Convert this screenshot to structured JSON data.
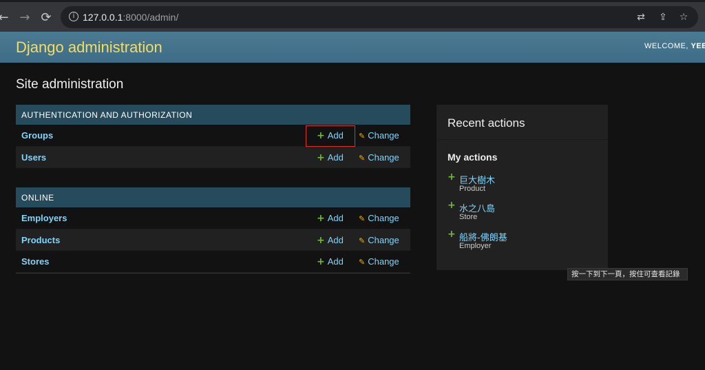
{
  "browser": {
    "back_icon": "←",
    "forward_icon": "→",
    "reload_icon": "⟳",
    "url_host": "127.0.0.1",
    "url_path": ":8000/admin/",
    "translate_icon": "⇄",
    "share_icon": "⇪",
    "star_icon": "☆"
  },
  "header": {
    "brand": "Django administration",
    "welcome": "WELCOME,",
    "username": "YEE"
  },
  "page_title": "Site administration",
  "modules": [
    {
      "caption": "AUTHENTICATION AND AUTHORIZATION",
      "models": [
        {
          "name": "Groups",
          "add": "Add",
          "change": "Change"
        },
        {
          "name": "Users",
          "add": "Add",
          "change": "Change"
        }
      ]
    },
    {
      "caption": "ONLINE",
      "models": [
        {
          "name": "Employers",
          "add": "Add",
          "change": "Change"
        },
        {
          "name": "Products",
          "add": "Add",
          "change": "Change"
        },
        {
          "name": "Stores",
          "add": "Add",
          "change": "Change"
        }
      ]
    }
  ],
  "recent": {
    "title": "Recent actions",
    "my_actions": "My actions",
    "items": [
      {
        "label": "巨大樹木",
        "type": "Product"
      },
      {
        "label": "水之八島",
        "type": "Store"
      },
      {
        "label": "船將-佛朗基",
        "type": "Employer"
      }
    ]
  },
  "tooltip": "按一下到下一頁，按住可查看記錄",
  "colors": {
    "header_bg": "#417690",
    "brand": "#f5dd5d",
    "caption_bg": "#264b5d",
    "link": "#81d4fa",
    "add_icon": "#70bf2b",
    "change_icon": "#efb80b",
    "highlight": "#e0302a"
  }
}
